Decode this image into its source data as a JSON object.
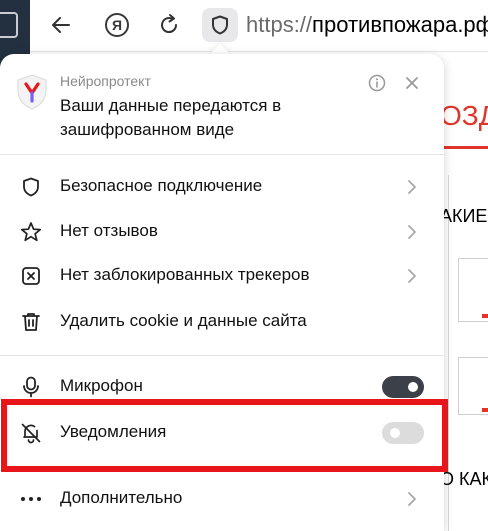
{
  "toolbar": {
    "url_scheme": "https://",
    "url_host": "противпожара.рф/",
    "ya_letter": "Я",
    "icons": [
      "back-arrow-icon",
      "yandex-icon",
      "reload-icon",
      "shield-icon"
    ]
  },
  "background_page": {
    "heading_fragment": "ОЗД",
    "text_fragment_1": "АКИЕ",
    "text_fragment_2": "О КАК"
  },
  "panel": {
    "brand": "Нейропротект",
    "message": "Ваши данные передаются в зашифрованном виде",
    "items": [
      {
        "label": "Безопасное подключение",
        "icon": "shield-icon",
        "has_chevron": true
      },
      {
        "label": "Нет отзывов",
        "icon": "star-icon",
        "has_chevron": true
      },
      {
        "label": "Нет заблокированных трекеров",
        "icon": "tracker-block-icon",
        "has_chevron": true
      },
      {
        "label": "Удалить cookie и данные сайта",
        "icon": "trash-icon",
        "has_chevron": false
      }
    ],
    "permissions": [
      {
        "label": "Микрофон",
        "icon": "microphone-icon",
        "enabled": true
      },
      {
        "label": "Уведомления",
        "icon": "bell-off-icon",
        "enabled": false
      }
    ],
    "more": {
      "label": "Дополнительно",
      "icon": "more-dots-icon"
    }
  },
  "colors": {
    "highlight": "#e8161b",
    "toggle_on": "#3c4048",
    "toggle_off": "#dcdcdc",
    "brand_red": "#e0352b",
    "dark_strip": "#22303f"
  }
}
